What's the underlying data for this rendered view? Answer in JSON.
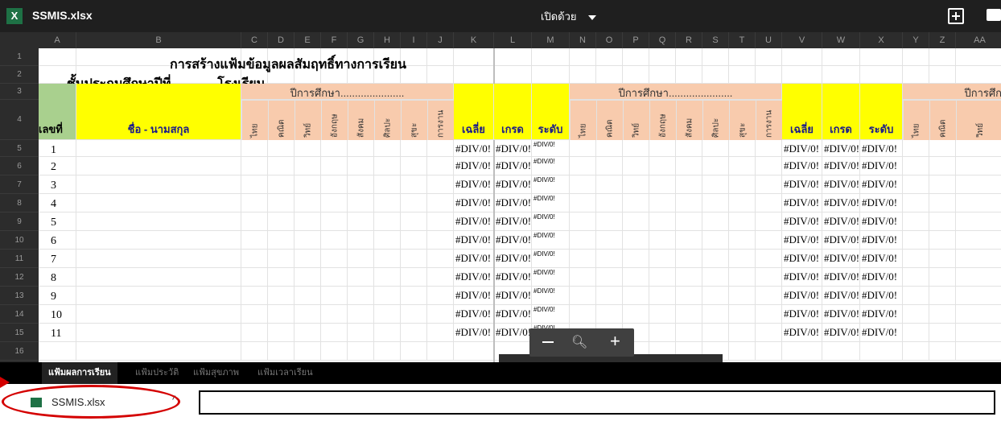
{
  "app": {
    "filename": "SSMIS.xlsx",
    "icon": "excel-icon",
    "open_with": "เปิดด้วย"
  },
  "columns": [
    "A",
    "B",
    "C",
    "D",
    "E",
    "F",
    "G",
    "H",
    "I",
    "J",
    "K",
    "L",
    "M",
    "N",
    "O",
    "P",
    "Q",
    "R",
    "S",
    "T",
    "U",
    "V",
    "W",
    "X",
    "Y",
    "Z",
    "AA"
  ],
  "rows": [
    "1",
    "2",
    "3",
    "4",
    "5",
    "6",
    "7",
    "8",
    "9",
    "10",
    "11",
    "12",
    "13",
    "14",
    "15",
    "16"
  ],
  "sheet": {
    "title_line1": "การสร้างแฟ้มข้อมูลผลสัมฤทธิ์ทางการเรียน",
    "title_line2": "ชั้นประถมศึกษาปีที่............ โรงเรียน..........................................................",
    "header": {
      "number": "เลขที่",
      "name": "ชื่อ - นามสกุล",
      "year_label": "ปีการศึกษา......................",
      "year_label_cut": "ปีการศึก",
      "subjects": [
        "ไทย",
        "คณิต",
        "วิทย์",
        "อังกฤษ",
        "สังคม",
        "ศิลปะ",
        "สุขะ",
        "การงาน"
      ],
      "avg": "เฉลี่ย",
      "grade": "เกรด",
      "level": "ระดับ"
    },
    "student_numbers": [
      "1",
      "2",
      "3",
      "4",
      "5",
      "6",
      "7",
      "8",
      "9",
      "10",
      "11"
    ],
    "error": "#DIV/0!"
  },
  "zoom": {
    "minus_icon": "minus-icon",
    "search_icon": "magnifier-icon",
    "plus_icon": "plus-icon"
  },
  "tabs": [
    "แฟ้มผลการเรียน",
    "แฟ้มประวัติ",
    "แฟ้มสุขภาพ",
    "แฟ้มเวลาเรียน"
  ],
  "download": {
    "filename": "SSMIS.xlsx",
    "chevron": "^"
  },
  "colors": {
    "peach": "#f8cbad",
    "yellow": "#ffff00",
    "green": "#a9d08e",
    "annotation": "#d40000"
  }
}
